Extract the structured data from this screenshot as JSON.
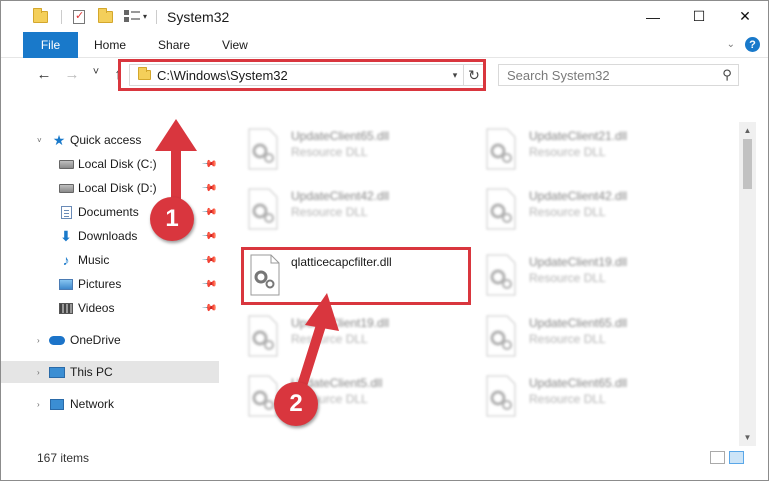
{
  "window": {
    "title": "System32",
    "minimize": "—",
    "maximize": "☐",
    "close": "✕"
  },
  "ribbon": {
    "file": "File",
    "home": "Home",
    "share": "Share",
    "view": "View",
    "help": "?"
  },
  "nav": {
    "back": "←",
    "forward": "→",
    "recent": "˅",
    "up": "↑",
    "address": "C:\\Windows\\System32",
    "refresh": "↻",
    "search_placeholder": "Search System32"
  },
  "sidebar": {
    "items": [
      {
        "label": "Quick access"
      },
      {
        "label": "Local Disk (C:)"
      },
      {
        "label": "Local Disk (D:)"
      },
      {
        "label": "Documents"
      },
      {
        "label": "Downloads"
      },
      {
        "label": "Music"
      },
      {
        "label": "Pictures"
      },
      {
        "label": "Videos"
      },
      {
        "label": "OneDrive"
      },
      {
        "label": "This PC"
      },
      {
        "label": "Network"
      }
    ]
  },
  "files": [
    {
      "name": "UpdateClient65.dll",
      "type": "Resource DLL"
    },
    {
      "name": "UpdateClient21.dll",
      "type": "Resource DLL"
    },
    {
      "name": "UpdateClient42.dll",
      "type": "Resource DLL"
    },
    {
      "name": "UpdateClient42.dll",
      "type": "Resource DLL"
    },
    {
      "name": "qlatticecapcfilter.dll",
      "type": ""
    },
    {
      "name": "UpdateClient19.dll",
      "type": "Resource DLL"
    },
    {
      "name": "UpdateClient19.dll",
      "type": "Resource DLL"
    },
    {
      "name": "UpdateClient65.dll",
      "type": "Resource DLL"
    },
    {
      "name": "UpdateClient5.dll",
      "type": "Resource DLL"
    },
    {
      "name": "UpdateClient65.dll",
      "type": "Resource DLL"
    }
  ],
  "status": {
    "count": "167 items"
  },
  "annotations": {
    "step1": "1",
    "step2": "2"
  },
  "colors": {
    "accent": "#1979ca",
    "highlight": "#d9363e"
  }
}
